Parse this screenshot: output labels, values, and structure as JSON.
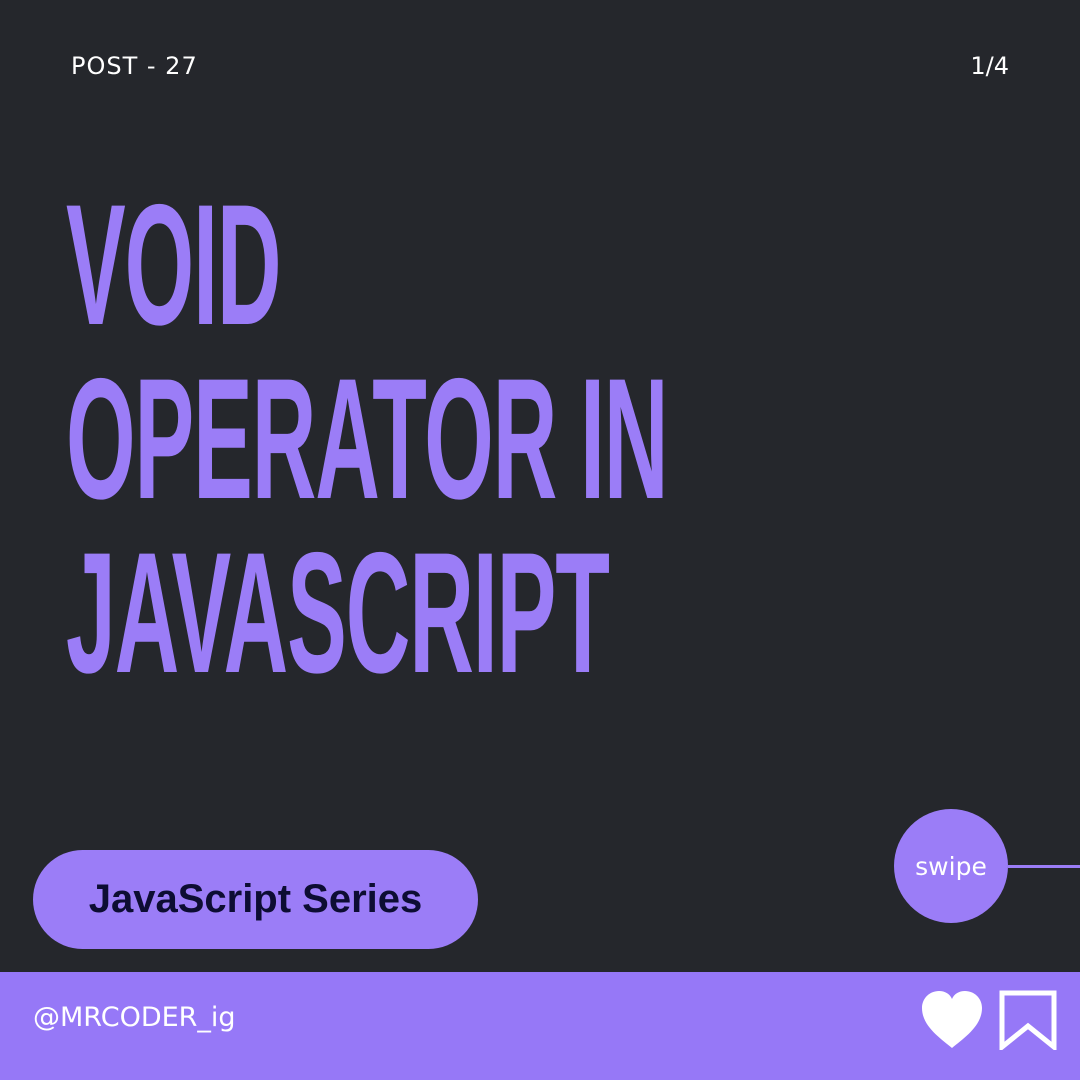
{
  "header": {
    "post_label": "POST - 27",
    "page_indicator": "1/4"
  },
  "title": {
    "lines": [
      "VOID",
      "OPERATOR IN",
      "JAVASCRIPT"
    ]
  },
  "series": {
    "label": "JavaScript Series"
  },
  "swipe": {
    "label": "swipe"
  },
  "footer": {
    "handle": "@MRCODER_ig",
    "icons": [
      "heart-icon",
      "bookmark-icon"
    ]
  },
  "colors": {
    "background": "#25272c",
    "accent": "#9b7df7",
    "footer": "#9678f7",
    "pill_text": "#0d0d33"
  }
}
